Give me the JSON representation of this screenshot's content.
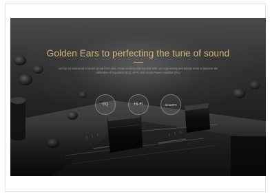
{
  "hero": {
    "headline": "Golden Ears to perfecting the tune of sound",
    "description": "Led by connoisseurs of music group from oklo, Oriole working side-by-side with our engineering and design team to improve the calibration of Equalizer (EQ), Hi-Fi, and Smart Power Amplifier (PA).",
    "features": [
      {
        "label": "EQ"
      },
      {
        "label": "Hi-Fi"
      },
      {
        "label": "SmartPA"
      }
    ]
  },
  "colors": {
    "headline": "#d4b77a",
    "background": "#1c1c1c"
  }
}
